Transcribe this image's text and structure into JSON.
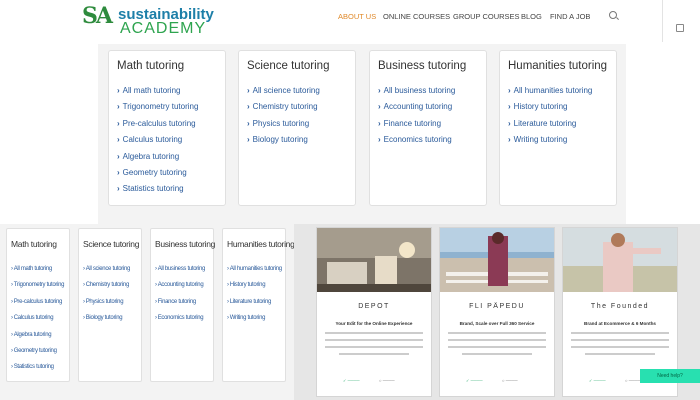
{
  "header": {
    "logo_mark": "SA",
    "logo_line1": "sustainability",
    "logo_line2": "ACADEMY",
    "nav": [
      "ABOUT US",
      "ONLINE COURSES",
      "GROUP COURSES",
      "BLOG",
      "FIND A JOB"
    ],
    "accent_color": "#e08a2b"
  },
  "menu": {
    "columns": [
      {
        "title": "Math tutoring",
        "items": [
          "All math tutoring",
          "Trigonometry tutoring",
          "Pre-calculus tutoring",
          "Calculus tutoring",
          "Algebra tutoring",
          "Geometry tutoring",
          "Statistics tutoring"
        ]
      },
      {
        "title": "Science tutoring",
        "items": [
          "All science tutoring",
          "Chemistry tutoring",
          "Physics tutoring",
          "Biology tutoring"
        ]
      },
      {
        "title": "Business tutoring",
        "items": [
          "All business tutoring",
          "Accounting tutoring",
          "Finance tutoring",
          "Economics tutoring"
        ]
      },
      {
        "title": "Humanities tutoring",
        "items": [
          "All humanities tutoring",
          "History tutoring",
          "Literature tutoring",
          "Writing tutoring"
        ]
      }
    ]
  },
  "small_menu": {
    "columns": [
      {
        "title": "Math tutoring",
        "items": [
          "All math tutoring",
          "Trigonometry tutoring",
          "Pre-calculus tutoring",
          "Calculus tutoring",
          "Algebra tutoring",
          "Geometry tutoring",
          "Statistics tutoring"
        ]
      },
      {
        "title": "Science tutoring",
        "items": [
          "All science tutoring",
          "Chemistry tutoring",
          "Physics tutoring",
          "Biology tutoring"
        ]
      },
      {
        "title": "Business tutoring",
        "items": [
          "All business tutoring",
          "Accounting tutoring",
          "Finance tutoring",
          "Economics tutoring"
        ]
      },
      {
        "title": "Humanities tutoring",
        "items": [
          "All humanities tutoring",
          "History tutoring",
          "Literature tutoring",
          "Writing tutoring"
        ]
      }
    ]
  },
  "products": [
    {
      "name": "DEPOT",
      "subtitle": "Your Edit for the Online Experience"
    },
    {
      "name": "FLI PÄPEDU",
      "subtitle": "Brand, Scale over Full 360 Service"
    },
    {
      "name": "The Founded",
      "subtitle": "Brand at Ecommerce & 6 Months"
    }
  ],
  "support_label": "Need help?"
}
